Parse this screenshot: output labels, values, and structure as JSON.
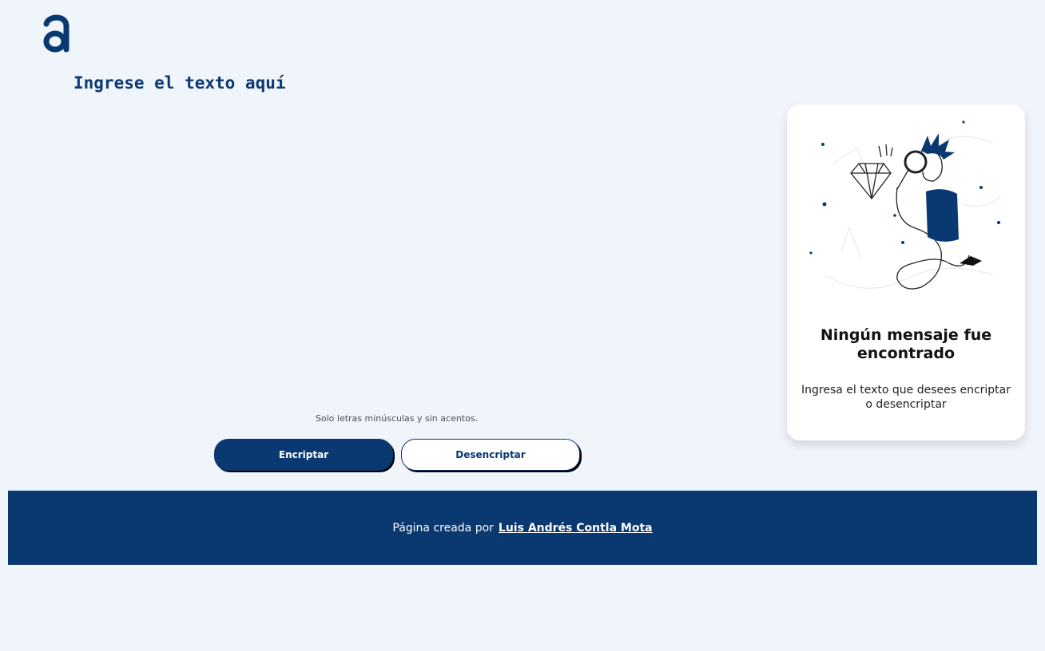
{
  "logo": {
    "icon": "alura-logo-icon",
    "color": "#0a3871"
  },
  "input": {
    "placeholder": "Ingrese el texto aquí",
    "value": ""
  },
  "hint": "Solo letras minúsculas y sin acentos.",
  "buttons": {
    "encrypt_label": "Encriptar",
    "decrypt_label": "Desencriptar"
  },
  "result_card": {
    "illustration": "person-with-magnifier-illustration",
    "title": "Ningún mensaje fue encontrado",
    "text": "Ingresa el texto que desees encriptar o desencriptar"
  },
  "footer": {
    "prefix": "Página creada por",
    "author_link": "Luis Andrés Contla Mota"
  },
  "colors": {
    "primary": "#0a3871",
    "background": "#f0f4fb",
    "card": "#ffffff"
  }
}
